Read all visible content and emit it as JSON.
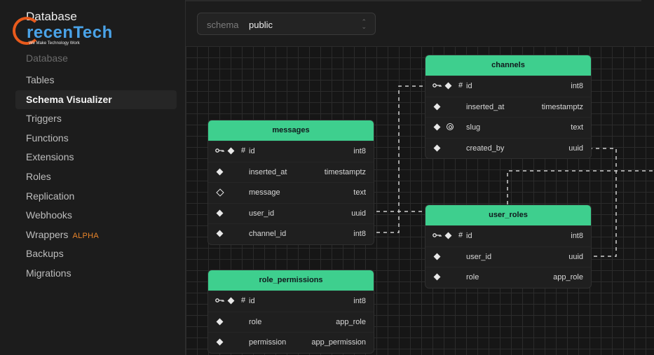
{
  "sidebar": {
    "title": "Database",
    "logo": {
      "brand": "recenTech",
      "tagline": "We Make Technology Work"
    },
    "section_label": "Database",
    "items": [
      {
        "label": "Tables"
      },
      {
        "label": "Schema Visualizer",
        "active": true
      },
      {
        "label": "Triggers"
      },
      {
        "label": "Functions"
      },
      {
        "label": "Extensions"
      },
      {
        "label": "Roles"
      },
      {
        "label": "Replication"
      },
      {
        "label": "Webhooks"
      },
      {
        "label": "Wrappers",
        "badge": "ALPHA"
      },
      {
        "label": "Backups"
      },
      {
        "label": "Migrations"
      }
    ]
  },
  "schema_select": {
    "label": "schema",
    "value": "public"
  },
  "colors": {
    "accent": "#3ecf8e",
    "badge": "#e8842a",
    "background": "#1c1c1c",
    "canvas": "#161616"
  },
  "tables": {
    "channels": {
      "name": "channels",
      "columns": [
        {
          "name": "id",
          "type": "int8",
          "icons": [
            "key-icon",
            "diamond-icon",
            "hash-icon"
          ]
        },
        {
          "name": "inserted_at",
          "type": "timestamptz",
          "icons": [
            "diamond-icon"
          ]
        },
        {
          "name": "slug",
          "type": "text",
          "icons": [
            "diamond-icon",
            "fingerprint-icon"
          ]
        },
        {
          "name": "created_by",
          "type": "uuid",
          "icons": [
            "diamond-icon"
          ]
        }
      ]
    },
    "messages": {
      "name": "messages",
      "columns": [
        {
          "name": "id",
          "type": "int8",
          "icons": [
            "key-icon",
            "diamond-icon",
            "hash-icon"
          ]
        },
        {
          "name": "inserted_at",
          "type": "timestamptz",
          "icons": [
            "diamond-icon"
          ]
        },
        {
          "name": "message",
          "type": "text",
          "icons": [
            "hollow-diamond-icon"
          ]
        },
        {
          "name": "user_id",
          "type": "uuid",
          "icons": [
            "diamond-icon"
          ]
        },
        {
          "name": "channel_id",
          "type": "int8",
          "icons": [
            "diamond-icon"
          ]
        }
      ]
    },
    "user_roles": {
      "name": "user_roles",
      "columns": [
        {
          "name": "id",
          "type": "int8",
          "icons": [
            "key-icon",
            "diamond-icon",
            "hash-icon"
          ]
        },
        {
          "name": "user_id",
          "type": "uuid",
          "icons": [
            "diamond-icon"
          ]
        },
        {
          "name": "role",
          "type": "app_role",
          "icons": [
            "diamond-icon"
          ]
        }
      ]
    },
    "role_permissions": {
      "name": "role_permissions",
      "columns": [
        {
          "name": "id",
          "type": "int8",
          "icons": [
            "key-icon",
            "diamond-icon",
            "hash-icon"
          ]
        },
        {
          "name": "role",
          "type": "app_role",
          "icons": [
            "diamond-icon"
          ]
        },
        {
          "name": "permission",
          "type": "app_permission",
          "icons": [
            "diamond-icon"
          ]
        }
      ]
    }
  }
}
